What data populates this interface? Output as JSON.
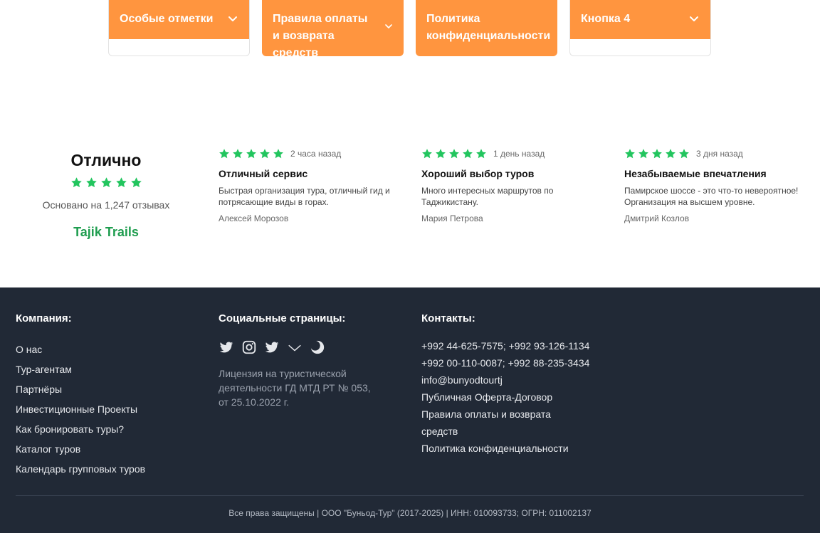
{
  "tabs": [
    {
      "label": "Особые отметки",
      "expanded": false
    },
    {
      "label": "Правила оплаты и возврата средств",
      "expanded": false
    },
    {
      "label": "Политика конфиденциальности",
      "expanded": false
    },
    {
      "label": "Кнопка 4",
      "expanded": false
    }
  ],
  "rating_summary": {
    "title": "Отлично",
    "stars": 5,
    "based_on": "Основано на 1,247 отзывах",
    "brand": "Tajik Trails"
  },
  "reviews": [
    {
      "stars": 5,
      "time": "2 часа назад",
      "title": "Отличный сервис",
      "text": "Быстрая организация тура, отличный гид и потрясающие виды в горах.",
      "author": "Алексей Морозов"
    },
    {
      "stars": 5,
      "time": "1 день назад",
      "title": "Хороший выбор туров",
      "text": "Много интересных маршрутов по Таджикистану.",
      "author": "Мария Петрова"
    },
    {
      "stars": 5,
      "time": "3 дня назад",
      "title": "Незабываемые впечатления",
      "text": "Памирское шоссе - это что-то невероятное! Организация на высшем уровне.",
      "author": "Дмитрий Козлов"
    }
  ],
  "footer": {
    "company": {
      "title": "Компания:",
      "links": [
        "О нас",
        "Тур-агентам",
        "Партнёры",
        "Инвестиционные Проекты",
        "Как бронировать туры?",
        "Каталог туров",
        "Календарь групповых туров"
      ]
    },
    "social": {
      "title": "Социальные страницы:",
      "icons": [
        "twitter-icon",
        "instagram-icon",
        "twitter-icon",
        "chevron-down-icon",
        "moon-icon"
      ],
      "license": "Лицензия на туристической деятельности ГД МТД РТ № 053, от 25.10.2022 г."
    },
    "contacts": {
      "title": "Контакты:",
      "phone1": "+992 44-625-7575; +992 93-126-1134",
      "phone2": "+992 00-110-0087; +992 88-235-3434",
      "email": "info@bunyodtourtj",
      "offer": "Публичная Оферта-Договор",
      "payment_rules": "Правила оплаты и возврата средств",
      "privacy": "Политика конфиденциальности"
    },
    "copyright": "Все права защищены | ООО \"Буньод-Тур\" (2017-2025) | ИНН: 010093733; ОГРН: 011002137"
  },
  "colors": {
    "accent": "#ff953f",
    "star": "#22c55e",
    "brand": "#1f9d4f",
    "footer_bg": "#212936"
  }
}
